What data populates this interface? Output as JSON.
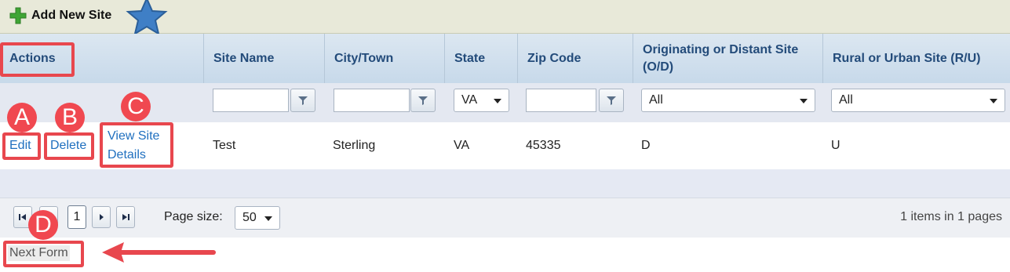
{
  "toolbar": {
    "add_label": "Add New Site"
  },
  "columns": [
    {
      "label": "Actions"
    },
    {
      "label": "Site Name"
    },
    {
      "label": "City/Town"
    },
    {
      "label": "State"
    },
    {
      "label": "Zip Code"
    },
    {
      "label": "Originating or Distant Site (O/D)"
    },
    {
      "label": "Rural or Urban Site (R/U)"
    }
  ],
  "filters": {
    "state_value": "VA",
    "od_value": "All",
    "ru_value": "All"
  },
  "row": {
    "actions": {
      "edit": "Edit",
      "delete": "Delete",
      "view": "View Site Details"
    },
    "site_name": "Test",
    "city": "Sterling",
    "state": "VA",
    "zip": "45335",
    "od": "D",
    "ru": "U"
  },
  "pager": {
    "current_page": "1",
    "page_size_label": "Page size:",
    "page_size": "50",
    "items_info": "1 items in 1 pages"
  },
  "next_form": "Next Form",
  "annotations": {
    "a": "A",
    "b": "B",
    "c": "C",
    "d": "D"
  },
  "colors": {
    "accent_red": "#e8474e",
    "link_blue": "#1f6fbf",
    "header_text": "#234b7a"
  }
}
